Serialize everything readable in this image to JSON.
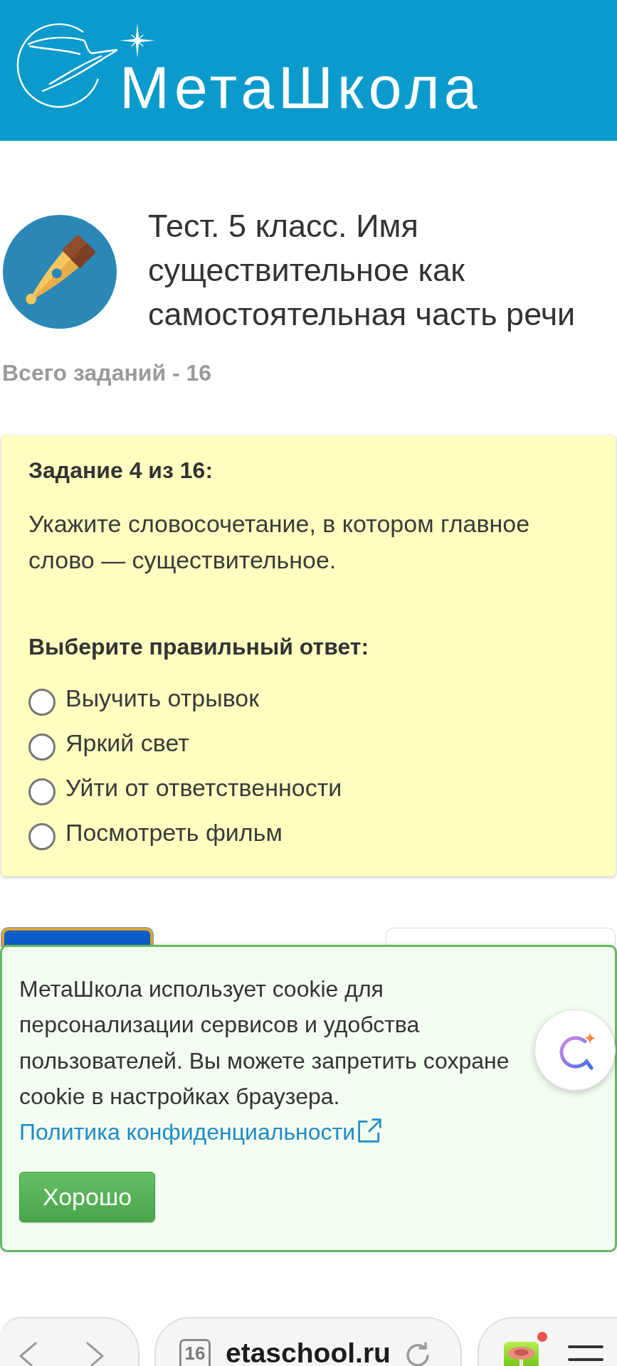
{
  "header": {
    "logo_text": "МетаШкола"
  },
  "test": {
    "title": "Тест. 5 класс. Имя существительное как самостоятельная часть речи",
    "task_count": "Всего заданий - 16"
  },
  "task": {
    "heading": "Задание 4 из 16:",
    "question": "Укажите словосочетание, в котором главное слово — существительное.",
    "prompt": "Выберите правильный ответ:",
    "options": [
      {
        "label": "Выучить отрывок",
        "selected": false
      },
      {
        "label": "Яркий свет",
        "selected": false
      },
      {
        "label": "Уйти от ответственности",
        "selected": false
      },
      {
        "label": "Посмотреть фильм",
        "selected": false
      }
    ]
  },
  "navigation_buttons": [
    {
      "kind": "primary"
    },
    {
      "kind": "secondary"
    }
  ],
  "cookie_banner": {
    "text": "МетаШкола использует cookie для персонализации сервисов и удобства пользователей. Вы можете запретить сохране cookie в настройках браузера.",
    "link": "Политика конфиденциальности",
    "button": "Хорошо"
  },
  "browser_bar": {
    "tab_count": "16",
    "address": "etaschool.ru"
  }
}
